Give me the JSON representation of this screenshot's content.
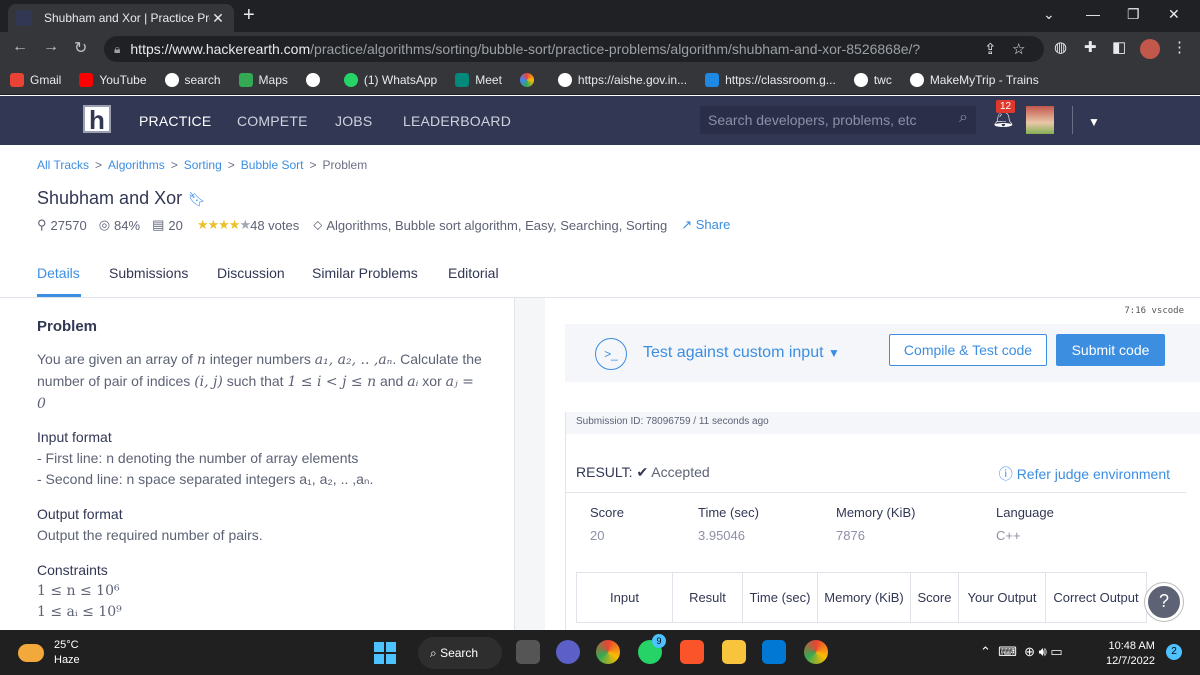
{
  "browser": {
    "tab_title": "Shubham and Xor | Practice Prob",
    "tab_close": "✕",
    "new_tab": "+",
    "url_host": "https://www.hackerearth.com",
    "url_path": "/practice/algorithms/sorting/bubble-sort/practice-problems/algorithm/shubham-and-xor-8526868e/?",
    "bookmarks": [
      {
        "label": "Gmail",
        "color": "#ea4335"
      },
      {
        "label": "YouTube",
        "color": "#ff0000"
      },
      {
        "label": "search",
        "color": "#ffffff"
      },
      {
        "label": "Maps",
        "color": "#34a853"
      },
      {
        "label": "",
        "color": "#ffffff"
      },
      {
        "label": "(1) WhatsApp",
        "color": "#25d366"
      },
      {
        "label": "Meet",
        "color": "#00897b"
      },
      {
        "label": "",
        "color": "#fbbc04"
      },
      {
        "label": "https://aishe.gov.in...",
        "color": "#ffffff"
      },
      {
        "label": "https://classroom.g...",
        "color": "#1e88e5"
      },
      {
        "label": "twc",
        "color": "#ffffff"
      },
      {
        "label": "MakeMyTrip - Trains",
        "color": "#ffffff"
      }
    ]
  },
  "site_nav": {
    "logo": "h",
    "links": [
      "PRACTICE",
      "COMPETE",
      "JOBS",
      "LEADERBOARD"
    ],
    "search_placeholder": "Search developers, problems, etc",
    "notifications": "12"
  },
  "breadcrumb": {
    "items": [
      "All Tracks",
      "Algorithms",
      "Sorting",
      "Bubble Sort"
    ],
    "current": "Problem",
    "sep": ">"
  },
  "problem": {
    "title": "Shubham and Xor",
    "submissions": "27570",
    "success": "84%",
    "points": "20",
    "votes": "48 votes",
    "tags": "Algorithms, Bubble sort algorithm, Easy, Searching, Sorting",
    "share": "Share"
  },
  "tabs": [
    "Details",
    "Submissions",
    "Discussion",
    "Similar Problems",
    "Editorial"
  ],
  "statement": {
    "heading": "Problem",
    "input_heading": "Input format",
    "input_line1": "- First line: n denoting the number of array elements",
    "input_line2": "- Second line: n space separated integers a₁, a₂, .. ,aₙ.",
    "output_heading": "Output format",
    "output_text": "Output the required number of pairs.",
    "constraints_heading": "Constraints",
    "constraint1": "1 ≤ n ≤ 10⁶",
    "constraint2": "1 ≤ aᵢ ≤ 10⁹"
  },
  "editor": {
    "vscode_label": "7:16  vscode",
    "test_label": "Test against custom input",
    "compile_label": "Compile & Test code",
    "submit_label": "Submit code"
  },
  "submission": {
    "id_line": "Submission ID: 78096759 / 11 seconds ago",
    "result_label": "RESULT:",
    "result_value": "Accepted",
    "refer": "Refer judge environment",
    "stats": [
      {
        "label": "Score",
        "value": "20"
      },
      {
        "label": "Time (sec)",
        "value": "3.95046"
      },
      {
        "label": "Memory (KiB)",
        "value": "7876"
      },
      {
        "label": "Language",
        "value": "C++"
      }
    ],
    "table_headers": [
      "Input",
      "Result",
      "Time (sec)",
      "Memory (KiB)",
      "Score",
      "Your Output",
      "Correct Output"
    ]
  },
  "taskbar": {
    "temp": "25°C",
    "weather": "Haze",
    "search": "Search",
    "time": "10:48 AM",
    "date": "12/7/2022",
    "notif_count": "2",
    "whatsapp_badge": "9"
  }
}
